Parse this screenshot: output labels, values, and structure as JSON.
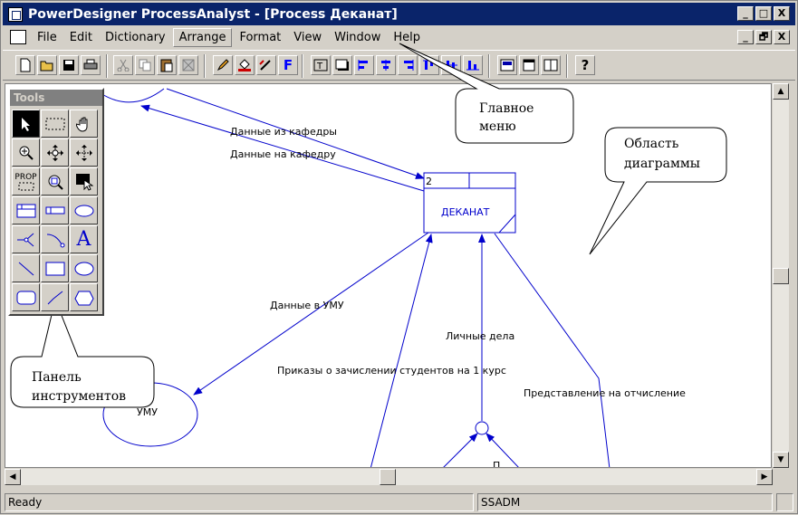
{
  "window": {
    "title": "PowerDesigner ProcessAnalyst - [Process Деканат]",
    "minimize": "_",
    "maximize": "□",
    "close": "X",
    "doc_restore": "🗗"
  },
  "menu": {
    "items": [
      "File",
      "Edit",
      "Dictionary",
      "Arrange",
      "Format",
      "View",
      "Window",
      "Help"
    ]
  },
  "tools_palette": {
    "title": "Tools",
    "prop_label": "PROP"
  },
  "diagram": {
    "process_number": "2",
    "process_name": "ДЕКАНАТ",
    "external_entity": "УМУ",
    "flows": {
      "from_dept": "Данные из кафедры",
      "to_dept": "Данные на кафедру",
      "to_umu": "Данные в УМУ",
      "personal_files": "Личные дела",
      "enrollment_orders": "Приказы о зачислении студентов на 1 курс",
      "expulsion": "Представление на отчисление",
      "cut_label": "П"
    }
  },
  "callouts": {
    "menu": [
      "Главное",
      "меню"
    ],
    "diagram_area": [
      "Область",
      "диаграммы"
    ],
    "tools_panel": [
      "Панель",
      "инструментов"
    ]
  },
  "status": {
    "left": "Ready",
    "middle": "SSADM"
  }
}
